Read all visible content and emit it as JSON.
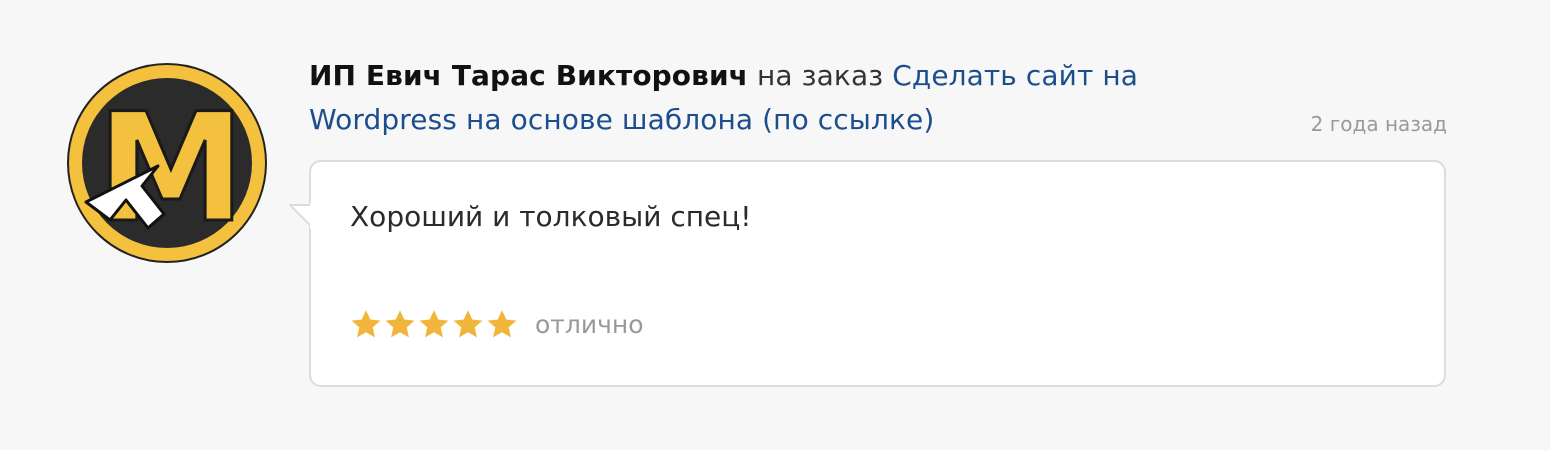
{
  "review": {
    "author": "ИП Евич Тарас Викторович",
    "connector": "на заказ",
    "order_title": "Сделать сайт на Wordpress на основе шаблона (по ссылке)",
    "time_ago": "2 года назад",
    "text": "Хороший и толковый спец!",
    "rating": {
      "stars": 5,
      "max": 5,
      "label": "отлично"
    },
    "avatar": {
      "icon": "m-letter-logo-icon",
      "letter": "M"
    }
  },
  "colors": {
    "background": "#f7f7f7",
    "link": "#1c4e8e",
    "muted": "#999999",
    "star": "#f2b53b",
    "avatar_yellow": "#f4c13e",
    "avatar_dark": "#2b2b2b"
  }
}
